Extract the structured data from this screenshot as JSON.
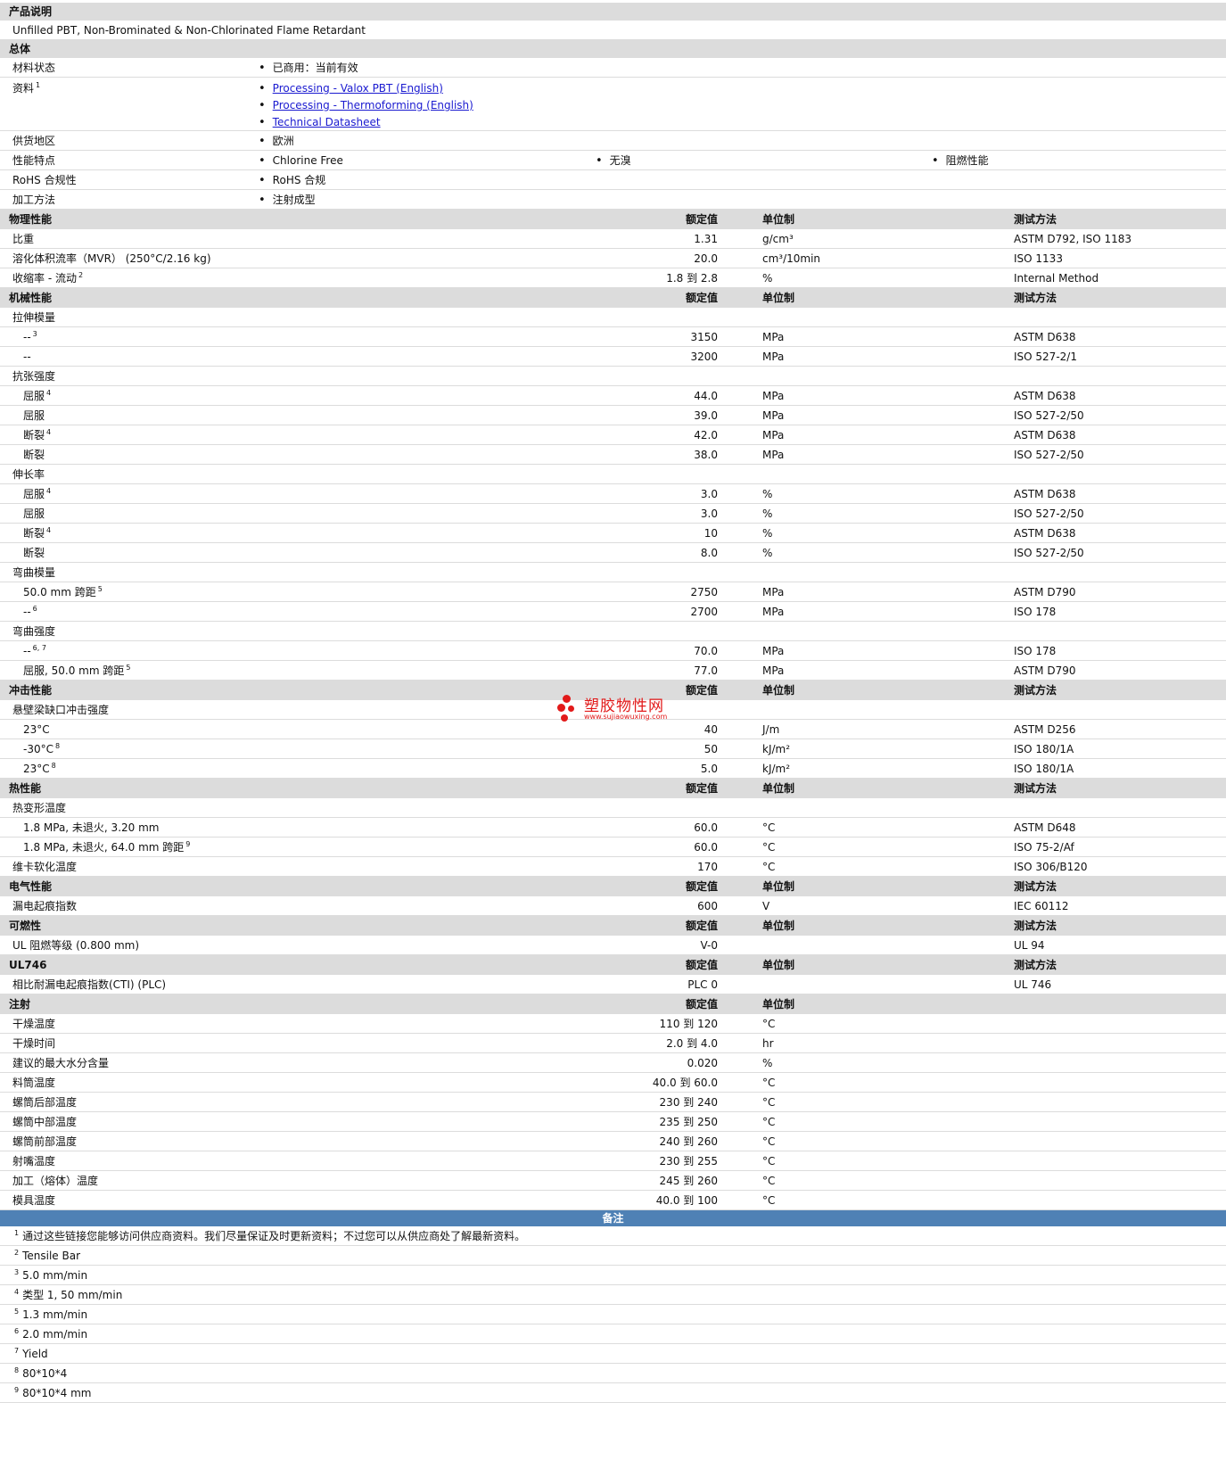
{
  "product": {
    "heading": "产品说明",
    "description": "Unfilled PBT, Non-Brominated & Non-Chlorinated Flame Retardant"
  },
  "general": {
    "heading": "总体",
    "material_status": {
      "label": "材料状态",
      "value": "已商用：当前有效"
    },
    "literature": {
      "label": "资料",
      "sup": "1",
      "links": [
        "Processing - Valox PBT (English)",
        "Processing - Thermoforming (English)",
        "Technical Datasheet"
      ]
    },
    "availability": {
      "label": "供货地区",
      "value": "欧洲"
    },
    "features": {
      "label": "性能特点",
      "values": [
        "Chlorine Free",
        "无溴",
        "阻燃性能"
      ]
    },
    "rohs": {
      "label": "RoHS 合规性",
      "value": "RoHS 合规"
    },
    "processing": {
      "label": "加工方法",
      "value": "注射成型"
    }
  },
  "col": {
    "nominal": "额定值",
    "unit": "单位制",
    "method": "测试方法"
  },
  "physical": {
    "heading": "物理性能",
    "rows": [
      {
        "label": "比重",
        "sup": "",
        "value": "1.31",
        "unit": "g/cm³",
        "method": "ASTM D792, ISO 1183"
      },
      {
        "label": "溶化体积流率（MVR） (250°C/2.16 kg)",
        "sup": "",
        "value": "20.0",
        "unit": "cm³/10min",
        "method": "ISO 1133"
      },
      {
        "label": "收缩率 - 流动",
        "sup": "2",
        "value": "1.8 到  2.8",
        "unit": "%",
        "method": "Internal Method"
      }
    ]
  },
  "mechanical": {
    "heading": "机械性能",
    "tensile_modulus": {
      "label": "拉伸模量",
      "rows": [
        {
          "label": "--",
          "sup": "3",
          "value": "3150",
          "unit": "MPa",
          "method": "ASTM D638"
        },
        {
          "label": "--",
          "sup": "",
          "value": "3200",
          "unit": "MPa",
          "method": "ISO 527-2/1"
        }
      ]
    },
    "tensile_strength": {
      "label": "抗张强度",
      "rows": [
        {
          "label": "屈服",
          "sup": "4",
          "value": "44.0",
          "unit": "MPa",
          "method": "ASTM D638"
        },
        {
          "label": "屈服",
          "sup": "",
          "value": "39.0",
          "unit": "MPa",
          "method": "ISO 527-2/50"
        },
        {
          "label": "断裂",
          "sup": "4",
          "value": "42.0",
          "unit": "MPa",
          "method": "ASTM D638"
        },
        {
          "label": "断裂",
          "sup": "",
          "value": "38.0",
          "unit": "MPa",
          "method": "ISO 527-2/50"
        }
      ]
    },
    "elongation": {
      "label": "伸长率",
      "rows": [
        {
          "label": "屈服",
          "sup": "4",
          "value": "3.0",
          "unit": "%",
          "method": "ASTM D638"
        },
        {
          "label": "屈服",
          "sup": "",
          "value": "3.0",
          "unit": "%",
          "method": "ISO 527-2/50"
        },
        {
          "label": "断裂",
          "sup": "4",
          "value": "10",
          "unit": "%",
          "method": "ASTM D638"
        },
        {
          "label": "断裂",
          "sup": "",
          "value": "8.0",
          "unit": "%",
          "method": "ISO 527-2/50"
        }
      ]
    },
    "flex_modulus": {
      "label": "弯曲模量",
      "rows": [
        {
          "label": "50.0 mm 跨距",
          "sup": "5",
          "value": "2750",
          "unit": "MPa",
          "method": "ASTM D790"
        },
        {
          "label": "--",
          "sup": "6",
          "value": "2700",
          "unit": "MPa",
          "method": "ISO 178"
        }
      ]
    },
    "flex_strength": {
      "label": "弯曲强度",
      "rows": [
        {
          "label": "--",
          "sup": "6, 7",
          "value": "70.0",
          "unit": "MPa",
          "method": "ISO 178"
        },
        {
          "label": "屈服, 50.0 mm 跨距",
          "sup": "5",
          "value": "77.0",
          "unit": "MPa",
          "method": "ASTM D790"
        }
      ]
    }
  },
  "impact": {
    "heading": "冲击性能",
    "izod": {
      "label": "悬壁梁缺口冲击强度",
      "rows": [
        {
          "label": "23°C",
          "sup": "",
          "value": "40",
          "unit": "J/m",
          "method": "ASTM D256"
        },
        {
          "label": "-30°C",
          "sup": "8",
          "value": "50",
          "unit": "kJ/m²",
          "method": "ISO 180/1A"
        },
        {
          "label": "23°C",
          "sup": "8",
          "value": "5.0",
          "unit": "kJ/m²",
          "method": "ISO 180/1A"
        }
      ]
    }
  },
  "thermal": {
    "heading": "热性能",
    "hdt": {
      "label": "热变形温度",
      "rows": [
        {
          "label": "1.8 MPa, 未退火, 3.20 mm",
          "sup": "",
          "value": "60.0",
          "unit": "°C",
          "method": "ASTM D648"
        },
        {
          "label": "1.8 MPa, 未退火, 64.0 mm 跨距",
          "sup": "9",
          "value": "60.0",
          "unit": "°C",
          "method": "ISO 75-2/Af"
        }
      ]
    },
    "vicat": {
      "label": "维卡软化温度",
      "value": "170",
      "unit": "°C",
      "method": "ISO 306/B120"
    }
  },
  "electrical": {
    "heading": "电气性能",
    "cti": {
      "label": "漏电起痕指数",
      "value": "600",
      "unit": "V",
      "method": "IEC 60112"
    }
  },
  "flammability": {
    "heading": "可燃性",
    "ul": {
      "label": "UL 阻燃等级 (0.800 mm)",
      "value": "V-0",
      "unit": "",
      "method": "UL 94"
    }
  },
  "ul746": {
    "heading": "UL746",
    "cti_plc": {
      "label": "相比耐漏电起痕指数(CTI) (PLC)",
      "value": "PLC 0",
      "unit": "",
      "method": "UL 746"
    }
  },
  "injection": {
    "heading": "注射",
    "rows": [
      {
        "label": "干燥温度",
        "value": "110 到  120",
        "unit": "°C"
      },
      {
        "label": "干燥时间",
        "value": "2.0 到  4.0",
        "unit": "hr"
      },
      {
        "label": "建议的最大水分含量",
        "value": "0.020",
        "unit": "%"
      },
      {
        "label": "料筒温度",
        "value": "40.0 到  60.0",
        "unit": "°C"
      },
      {
        "label": "螺筒后部温度",
        "value": "230 到  240",
        "unit": "°C"
      },
      {
        "label": "螺筒中部温度",
        "value": "235 到  250",
        "unit": "°C"
      },
      {
        "label": "螺筒前部温度",
        "value": "240 到  260",
        "unit": "°C"
      },
      {
        "label": "射嘴温度",
        "value": "230 到  255",
        "unit": "°C"
      },
      {
        "label": "加工（熔体）温度",
        "value": "245 到  260",
        "unit": "°C"
      },
      {
        "label": "模具温度",
        "value": "40.0 到  100",
        "unit": "°C"
      }
    ]
  },
  "notes": {
    "heading": "备注",
    "items": [
      {
        "num": "1",
        "text": "通过这些链接您能够访问供应商资料。我们尽量保证及时更新资料；不过您可以从供应商处了解最新资料。"
      },
      {
        "num": "2",
        "text": "Tensile Bar"
      },
      {
        "num": "3",
        "text": "5.0 mm/min"
      },
      {
        "num": "4",
        "text": "类型  1, 50 mm/min"
      },
      {
        "num": "5",
        "text": "1.3 mm/min"
      },
      {
        "num": "6",
        "text": "2.0 mm/min"
      },
      {
        "num": "7",
        "text": "Yield"
      },
      {
        "num": "8",
        "text": "80*10*4"
      },
      {
        "num": "9",
        "text": "80*10*4 mm"
      }
    ]
  },
  "watermark": {
    "name": "塑胶物性网",
    "url": "www.sujiaowuxing.com"
  },
  "colors": {
    "header_bg": "#dcdcdc",
    "notes_bar": "#4f81b5",
    "link": "#1a1ad0",
    "watermark": "#e21a1a"
  }
}
